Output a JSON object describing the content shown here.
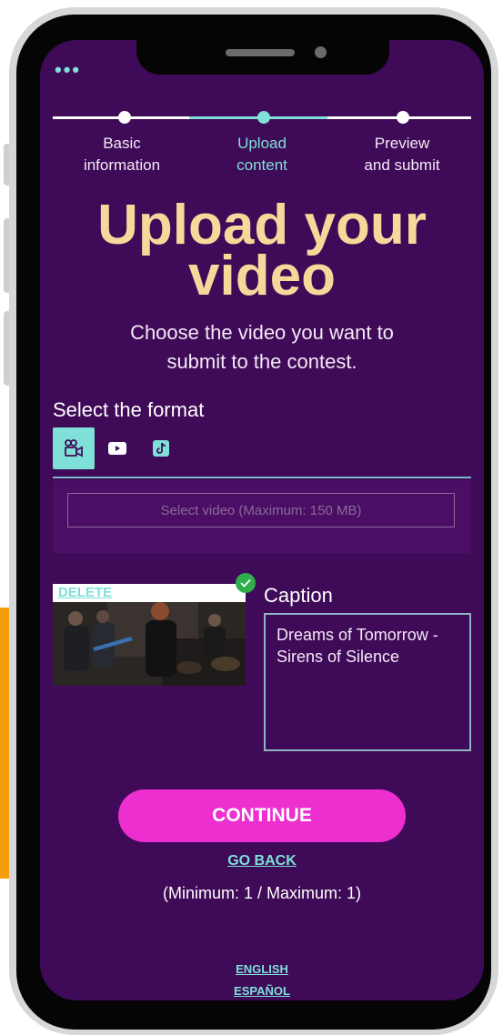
{
  "app": {
    "menu_icon": "more-horizontal-icon",
    "menu_text": "•••"
  },
  "steps": [
    {
      "label_line1": "Basic",
      "label_line2": "information",
      "state": "done"
    },
    {
      "label_line1": "Upload",
      "label_line2": "content",
      "state": "current"
    },
    {
      "label_line1": "Preview",
      "label_line2": "and submit",
      "state": "pending"
    }
  ],
  "page": {
    "title_line1": "Upload your",
    "title_line2": "video",
    "subtitle_line1": "Choose the video you want to",
    "subtitle_line2": "submit to the contest."
  },
  "format": {
    "label": "Select the format",
    "options": [
      {
        "icon": "video-camera-icon",
        "selected": true
      },
      {
        "icon": "youtube-icon",
        "selected": false
      },
      {
        "icon": "tiktok-icon",
        "selected": false
      }
    ]
  },
  "upload": {
    "select_video_label": "Select video  (Maximum: 150 MB)"
  },
  "uploaded_video": {
    "delete_label": "DELETE",
    "status_icon": "check-icon"
  },
  "caption": {
    "label": "Caption",
    "value": "Dreams of Tomorrow - Sirens of Silence"
  },
  "actions": {
    "continue_label": "CONTINUE",
    "go_back_label": "GO BACK",
    "limits_text": "(Minimum: 1 / Maximum: 1)"
  },
  "languages": [
    "ENGLISH",
    "ESPAÑOL"
  ],
  "colors": {
    "background": "#3f0a57",
    "accent_teal": "#7fe0d7",
    "title_gold": "#f6d99a",
    "primary_pink": "#ee2fcf",
    "success_green": "#2eaf4c"
  }
}
